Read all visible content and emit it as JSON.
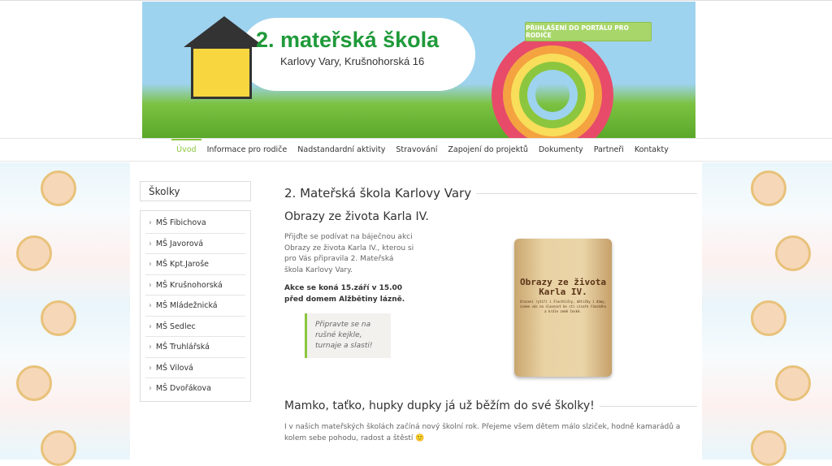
{
  "header": {
    "title": "2. mateřská škola",
    "subtitle": "Karlovy Vary, Krušnohorská 16",
    "portal_button": "PŘIHLÁŠENÍ DO PORTÁLU PRO RODIČE"
  },
  "nav": [
    "Úvod",
    "Informace pro rodiče",
    "Nadstandardní aktivity",
    "Stravování",
    "Zapojení do projektů",
    "Dokumenty",
    "Partneři",
    "Kontakty"
  ],
  "sidebar": {
    "title": "Školky",
    "items": [
      "MŠ Fibichova",
      "MŠ Javorová",
      "MŠ Kpt.Jaroše",
      "MŠ Krušnohorská",
      "MŠ Mládežnická",
      "MŠ Sedlec",
      "MŠ Truhlářská",
      "MŠ Vilová",
      "MŠ Dvořákova"
    ]
  },
  "main": {
    "heading": "2. Mateřská škola Karlovy Vary",
    "article_title": "Obrazy ze života Karla IV.",
    "intro": "Přijďte se podívat na báječnou akci Obrazy ze života Karla IV., kterou si pro Vás připravila 2. Mateřská škola Karlovy Vary.",
    "event": "Akce se koná 15.září v 15.00 před domem Alžbětiny lázně.",
    "quote": "Připravte se na rušné kejkle, turnaje a slasti!",
    "poster_title": "Obrazy ze života Karla IV.",
    "poster_text": "Urozeni rytíři i šlechtičny, dětičky i dámy, zveme vás na slavnost ke cti císaře římského a krále země české.",
    "second_heading": "Mamko, taťko, hupky dupky já už běžím do své školky!",
    "second_text": "I v našich mateřských školách začíná nový školní rok. Přejeme všem dětem málo slziček, hodně kamarádů a kolem sebe pohodu, radost a štěstí 🙂"
  },
  "colors": {
    "accent": "#8cc63f",
    "title_green": "#1f9a3a"
  }
}
